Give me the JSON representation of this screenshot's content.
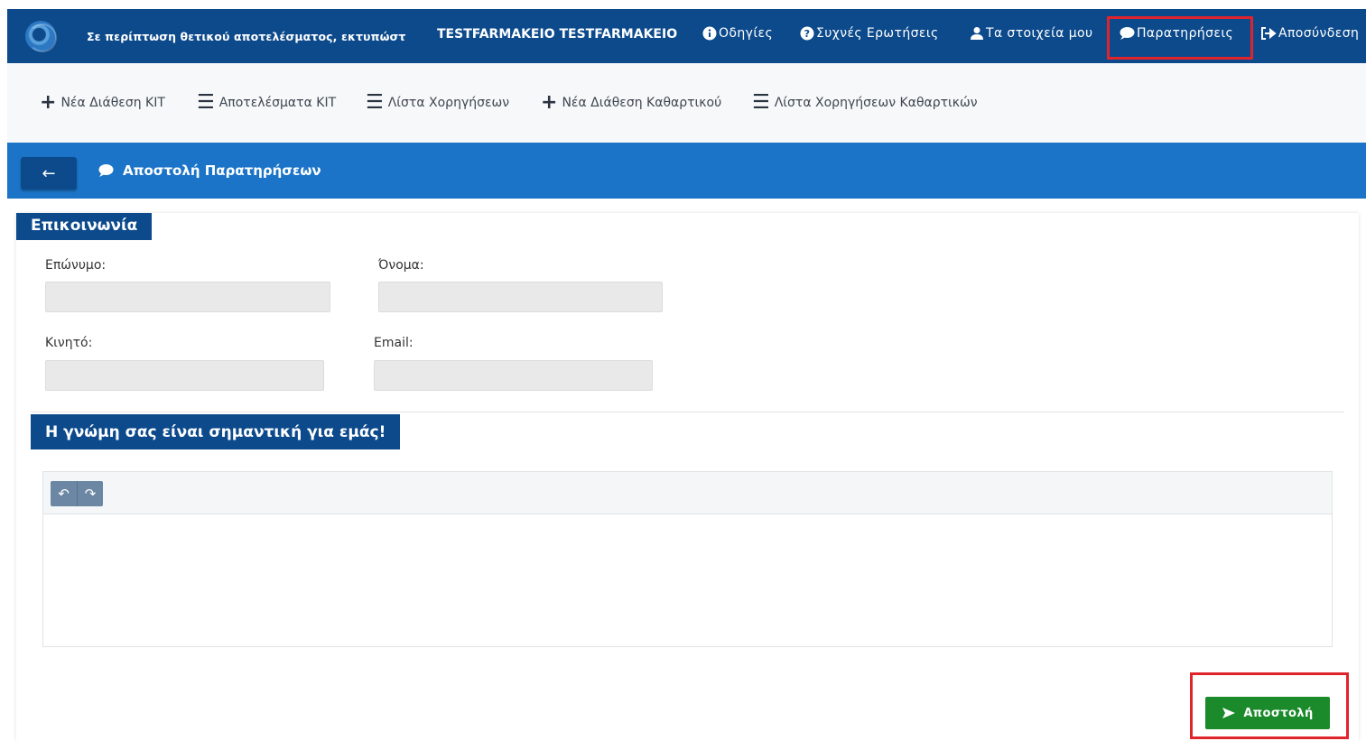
{
  "header": {
    "message": "Σε περίπτωση θετικού αποτελέσματος, εκτυπώστ",
    "user_name": "TESTFARMAKEIO TESTFARMAKEIO",
    "links": {
      "instructions": "Οδηγίες",
      "faq": "Συχνές Ερωτήσεις",
      "my_details": "Τα στοιχεία μου",
      "feedback": "Παρατηρήσεις",
      "logout": "Αποσύνδεση"
    }
  },
  "subnav": {
    "items": [
      {
        "label": "Νέα Διάθεση ΚΙΤ",
        "icon": "plus-icon"
      },
      {
        "label": "Αποτελέσματα ΚΙΤ",
        "icon": "list-icon"
      },
      {
        "label": "Λίστα Χορηγήσεων",
        "icon": "list-icon"
      },
      {
        "label": "Νέα Διάθεση Καθαρτικού",
        "icon": "plus-icon"
      },
      {
        "label": "Λίστα Χορηγήσεων Καθαρτικών",
        "icon": "list-icon"
      }
    ]
  },
  "page": {
    "title": "Αποστολή Παρατηρήσεων",
    "back_icon": "arrow-left-icon"
  },
  "contact": {
    "section_title": "Επικοινωνία",
    "surname_label": "Επώνυμο:",
    "surname_value": "",
    "name_label": "Όνομα:",
    "name_value": "",
    "mobile_label": "Κινητό:",
    "mobile_value": "",
    "email_label": "Email:",
    "email_value": ""
  },
  "feedback": {
    "section_title": "Η γνώμη σας είναι σημαντική για εμάς!",
    "text_value": "",
    "toolbar": [
      "undo-icon",
      "redo-icon"
    ]
  },
  "actions": {
    "send_label": "Αποστολή"
  },
  "colors": {
    "header": "#0c4a8c",
    "pagebar": "#1b74c7",
    "send_button": "#1a8a2a",
    "highlight": "#e0242c"
  }
}
